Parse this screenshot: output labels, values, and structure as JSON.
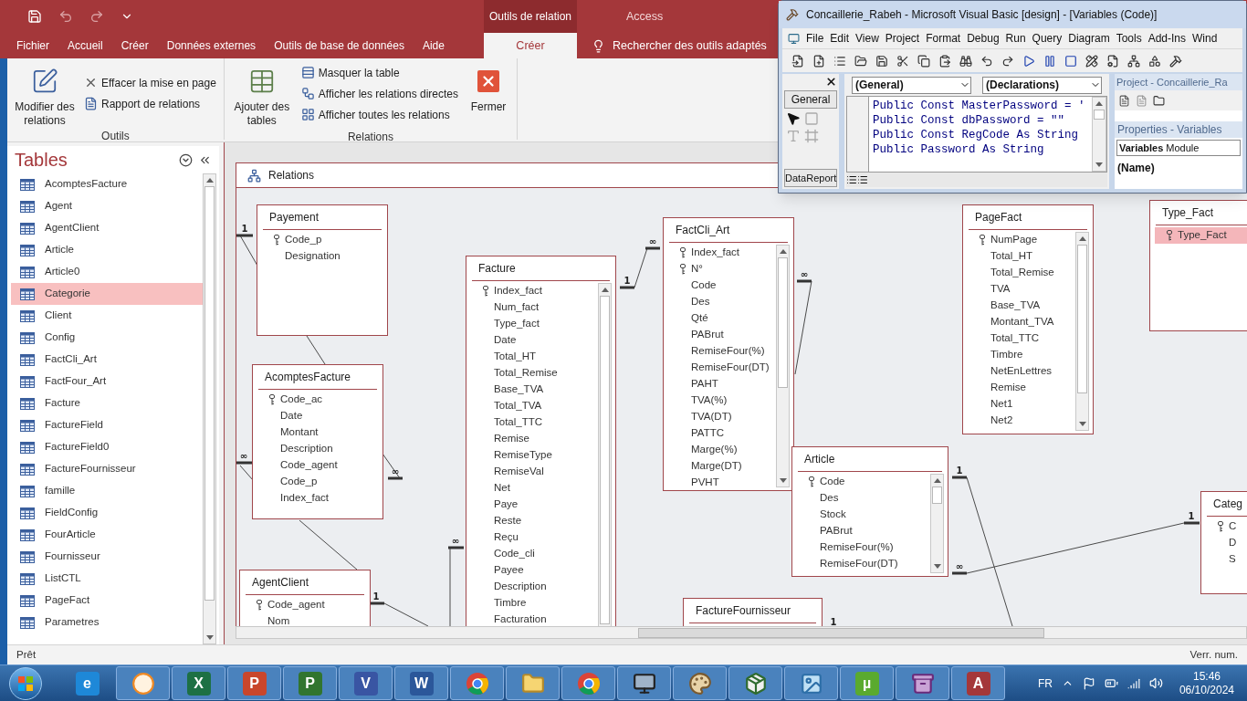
{
  "title_bar": {
    "context_label": "Outils de relation",
    "app_title": "Access"
  },
  "ribbon_tabs": [
    {
      "label": "Fichier",
      "selected": false
    },
    {
      "label": "Accueil",
      "selected": false
    },
    {
      "label": "Créer",
      "selected": false
    },
    {
      "label": "Données externes",
      "selected": false
    },
    {
      "label": "Outils de base de données",
      "selected": false
    },
    {
      "label": "Aide",
      "selected": false
    },
    {
      "label": "Créer",
      "selected": true
    }
  ],
  "tell_me": "Rechercher des outils adaptés",
  "ribbon_groups": [
    {
      "label": "Outils",
      "buttons": [
        {
          "label": "Modifier des relations",
          "kind": "large"
        },
        {
          "label": "Effacer la mise en page",
          "kind": "small"
        },
        {
          "label": "Rapport de relations",
          "kind": "small"
        }
      ]
    },
    {
      "label": "Relations",
      "buttons": [
        {
          "label": "Ajouter des tables",
          "kind": "large"
        },
        {
          "label": "Masquer la table",
          "kind": "small"
        },
        {
          "label": "Afficher les relations directes",
          "kind": "small"
        },
        {
          "label": "Afficher toutes les relations",
          "kind": "small"
        },
        {
          "label": "Fermer",
          "kind": "large"
        }
      ]
    }
  ],
  "navigation_pane": {
    "title": "Tables",
    "items": [
      {
        "label": "AcomptesFacture",
        "selected": false
      },
      {
        "label": "Agent",
        "selected": false
      },
      {
        "label": "AgentClient",
        "selected": false
      },
      {
        "label": "Article",
        "selected": false
      },
      {
        "label": "Article0",
        "selected": false
      },
      {
        "label": "Categorie",
        "selected": true
      },
      {
        "label": "Client",
        "selected": false
      },
      {
        "label": "Config",
        "selected": false
      },
      {
        "label": "FactCli_Art",
        "selected": false
      },
      {
        "label": "FactFour_Art",
        "selected": false
      },
      {
        "label": "Facture",
        "selected": false
      },
      {
        "label": "FactureField",
        "selected": false
      },
      {
        "label": "FactureField0",
        "selected": false
      },
      {
        "label": "FactureFournisseur",
        "selected": false
      },
      {
        "label": "famille",
        "selected": false
      },
      {
        "label": "FieldConfig",
        "selected": false
      },
      {
        "label": "FourArticle",
        "selected": false
      },
      {
        "label": "Fournisseur",
        "selected": false
      },
      {
        "label": "ListCTL",
        "selected": false
      },
      {
        "label": "PageFact",
        "selected": false
      },
      {
        "label": "Parametres",
        "selected": false
      }
    ]
  },
  "document_tab": "Relations",
  "tables": [
    {
      "title": "Payement",
      "fields": [
        {
          "name": "Code_p",
          "key": true,
          "selected": false
        },
        {
          "name": "Designation",
          "key": false,
          "selected": false
        }
      ]
    },
    {
      "title": "AcomptesFacture",
      "fields": [
        {
          "name": "Code_ac",
          "key": true,
          "selected": false
        },
        {
          "name": "Date",
          "key": false,
          "selected": false
        },
        {
          "name": "Montant",
          "key": false,
          "selected": false
        },
        {
          "name": "Description",
          "key": false,
          "selected": false
        },
        {
          "name": "Code_agent",
          "key": false,
          "selected": false
        },
        {
          "name": "Code_p",
          "key": false,
          "selected": false
        },
        {
          "name": "Index_fact",
          "key": false,
          "selected": false
        }
      ]
    },
    {
      "title": "AgentClient",
      "fields": [
        {
          "name": "Code_agent",
          "key": true,
          "selected": false
        },
        {
          "name": "Nom",
          "key": false,
          "selected": false
        }
      ]
    },
    {
      "title": "Facture",
      "fields": [
        {
          "name": "Index_fact",
          "key": true,
          "selected": false
        },
        {
          "name": "Num_fact",
          "key": false,
          "selected": false
        },
        {
          "name": "Type_fact",
          "key": false,
          "selected": false
        },
        {
          "name": "Date",
          "key": false,
          "selected": false
        },
        {
          "name": "Total_HT",
          "key": false,
          "selected": false
        },
        {
          "name": "Total_Remise",
          "key": false,
          "selected": false
        },
        {
          "name": "Base_TVA",
          "key": false,
          "selected": false
        },
        {
          "name": "Total_TVA",
          "key": false,
          "selected": false
        },
        {
          "name": "Total_TTC",
          "key": false,
          "selected": false
        },
        {
          "name": "Remise",
          "key": false,
          "selected": false
        },
        {
          "name": "RemiseType",
          "key": false,
          "selected": false
        },
        {
          "name": "RemiseVal",
          "key": false,
          "selected": false
        },
        {
          "name": "Net",
          "key": false,
          "selected": false
        },
        {
          "name": "Paye",
          "key": false,
          "selected": false
        },
        {
          "name": "Reste",
          "key": false,
          "selected": false
        },
        {
          "name": "Reçu",
          "key": false,
          "selected": false
        },
        {
          "name": "Code_cli",
          "key": false,
          "selected": false
        },
        {
          "name": "Payee",
          "key": false,
          "selected": false
        },
        {
          "name": "Description",
          "key": false,
          "selected": false
        },
        {
          "name": "Timbre",
          "key": false,
          "selected": false
        },
        {
          "name": "Facturation",
          "key": false,
          "selected": false
        }
      ]
    },
    {
      "title": "FactCli_Art",
      "fields": [
        {
          "name": "Index_fact",
          "key": true,
          "selected": false
        },
        {
          "name": "N°",
          "key": true,
          "selected": false
        },
        {
          "name": "Code",
          "key": false,
          "selected": false
        },
        {
          "name": "Des",
          "key": false,
          "selected": false
        },
        {
          "name": "Qté",
          "key": false,
          "selected": false
        },
        {
          "name": "PABrut",
          "key": false,
          "selected": false
        },
        {
          "name": "RemiseFour(%)",
          "key": false,
          "selected": false
        },
        {
          "name": "RemiseFour(DT)",
          "key": false,
          "selected": false
        },
        {
          "name": "PAHT",
          "key": false,
          "selected": false
        },
        {
          "name": "TVA(%)",
          "key": false,
          "selected": false
        },
        {
          "name": "TVA(DT)",
          "key": false,
          "selected": false
        },
        {
          "name": "PATTC",
          "key": false,
          "selected": false
        },
        {
          "name": "Marge(%)",
          "key": false,
          "selected": false
        },
        {
          "name": "Marge(DT)",
          "key": false,
          "selected": false
        },
        {
          "name": "PVHT",
          "key": false,
          "selected": false
        }
      ]
    },
    {
      "title": "FactureFournisseur"
    },
    {
      "title": "Article",
      "fields": [
        {
          "name": "Code",
          "key": true,
          "selected": false
        },
        {
          "name": "Des",
          "key": false,
          "selected": false
        },
        {
          "name": "Stock",
          "key": false,
          "selected": false
        },
        {
          "name": "PABrut",
          "key": false,
          "selected": false
        },
        {
          "name": "RemiseFour(%)",
          "key": false,
          "selected": false
        },
        {
          "name": "RemiseFour(DT)",
          "key": false,
          "selected": false
        }
      ]
    },
    {
      "title": "PageFact",
      "fields": [
        {
          "name": "NumPage",
          "key": true,
          "selected": false
        },
        {
          "name": "Total_HT",
          "key": false,
          "selected": false
        },
        {
          "name": "Total_Remise",
          "key": false,
          "selected": false
        },
        {
          "name": "TVA",
          "key": false,
          "selected": false
        },
        {
          "name": "Base_TVA",
          "key": false,
          "selected": false
        },
        {
          "name": "Montant_TVA",
          "key": false,
          "selected": false
        },
        {
          "name": "Total_TTC",
          "key": false,
          "selected": false
        },
        {
          "name": "Timbre",
          "key": false,
          "selected": false
        },
        {
          "name": "NetEnLettres",
          "key": false,
          "selected": false
        },
        {
          "name": "Remise",
          "key": false,
          "selected": false
        },
        {
          "name": "Net1",
          "key": false,
          "selected": false
        },
        {
          "name": "Net2",
          "key": false,
          "selected": false
        }
      ]
    },
    {
      "title": "Type_Fact",
      "fields": [
        {
          "name": "Type_Fact",
          "key": true,
          "selected": true
        }
      ]
    },
    {
      "title": "Categ",
      "fields": [
        {
          "name": "C",
          "key": true,
          "selected": false
        },
        {
          "name": "D",
          "key": false,
          "selected": false
        },
        {
          "name": "S",
          "key": false,
          "selected": false
        }
      ]
    }
  ],
  "relationships": [
    {
      "ends": [
        "1"
      ]
    },
    {
      "ends": [
        "∞"
      ]
    },
    {
      "ends": [
        "∞"
      ]
    },
    {
      "ends": [
        "1"
      ]
    },
    {
      "ends": [
        "∞"
      ]
    },
    {
      "ends": [
        "1",
        "∞"
      ]
    },
    {
      "ends": [
        "∞"
      ]
    },
    {
      "ends": [
        "1"
      ]
    },
    {
      "ends": [
        "∞",
        "1"
      ]
    },
    {
      "ends": [
        "1"
      ]
    }
  ],
  "status_bar": {
    "left": "Prêt",
    "right": "Verr. num."
  },
  "vb_window": {
    "title": "Concaillerie_Rabeh - Microsoft Visual Basic [design] - [Variables (Code)]",
    "menu": [
      "File",
      "Edit",
      "View",
      "Project",
      "Format",
      "Debug",
      "Run",
      "Query",
      "Diagram",
      "Tools",
      "Add-Ins",
      "Wind"
    ],
    "toolbox": {
      "tab": "General",
      "footer": "DataReport"
    },
    "code": {
      "object": "(General)",
      "procedure": "(Declarations)",
      "lines": [
        "Public Const MasterPassword = '",
        "Public Const dbPassword = \"\"",
        "Public Const RegCode As String",
        "Public Password As String"
      ]
    },
    "project_title": "Project - Concaillerie_Ra",
    "properties_title": "Properties - Variables",
    "properties_object": {
      "name": "Variables",
      "type": "Module"
    },
    "property": "(Name)"
  },
  "taskbar": {
    "apps": [
      {
        "kind": "letter",
        "glyph": "e",
        "color": "#1e88d8",
        "open": false
      },
      {
        "kind": "media",
        "open": true
      },
      {
        "kind": "letter",
        "glyph": "X",
        "color": "#1d7044",
        "open": true
      },
      {
        "kind": "letter",
        "glyph": "P",
        "color": "#c9462b",
        "open": true
      },
      {
        "kind": "letter",
        "glyph": "P",
        "color": "#31752f",
        "open": true
      },
      {
        "kind": "letter",
        "glyph": "V",
        "color": "#3955a3",
        "open": true
      },
      {
        "kind": "letter",
        "glyph": "W",
        "color": "#2b579a",
        "open": true
      },
      {
        "kind": "browser",
        "open": true
      },
      {
        "kind": "folder",
        "open": true
      },
      {
        "kind": "browser",
        "open": true
      },
      {
        "kind": "monitor",
        "open": true
      },
      {
        "kind": "palette",
        "open": true
      },
      {
        "kind": "installer",
        "open": true
      },
      {
        "kind": "photos",
        "open": true
      },
      {
        "kind": "letter",
        "glyph": "µ",
        "color": "#5aaa2f",
        "open": true
      },
      {
        "kind": "archive",
        "open": true
      },
      {
        "kind": "letter",
        "glyph": "A",
        "color": "#a4373a",
        "open": true
      }
    ],
    "language": "FR",
    "time": "15:46",
    "date": "06/10/2024"
  }
}
